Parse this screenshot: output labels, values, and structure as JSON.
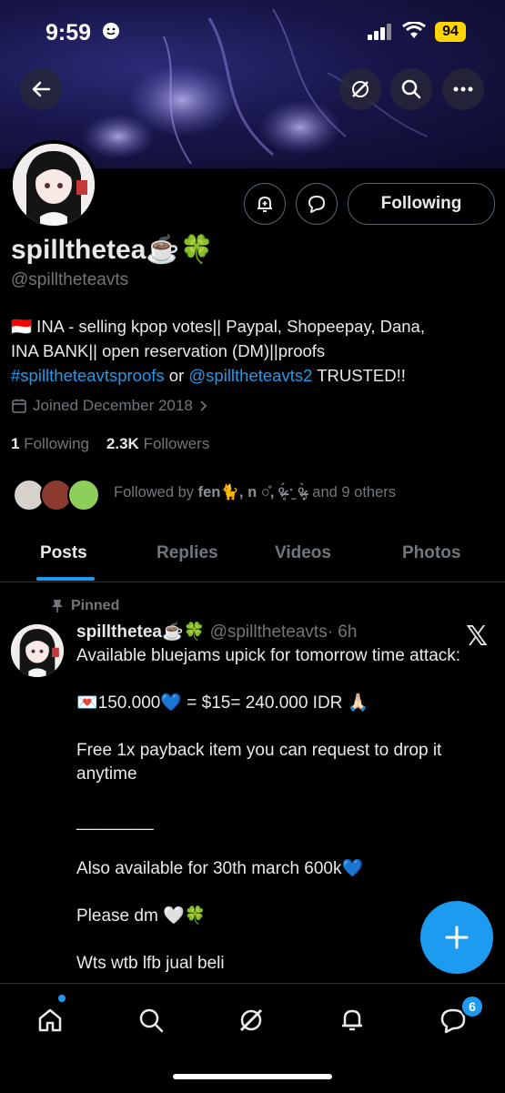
{
  "status_bar": {
    "time": "9:59",
    "battery": "94"
  },
  "profile": {
    "name": "spillthetea☕️🍀",
    "handle": "@spilltheteavts",
    "following_button": "Following",
    "bio": {
      "line1": "🇮🇩 INA - selling kpop votes|| Paypal, Shopeepay, Dana,",
      "line2": "INA BANK|| open reservation (DM)||proofs",
      "link1": "#spilltheteavtsproofs",
      "or": " or ",
      "link2": "@spilltheteavts2",
      "trusted": " TRUSTED!!"
    },
    "joined": "Joined December 2018",
    "following_count": "1",
    "following_label": "Following",
    "followers_count": "2.3K",
    "followers_label": "Followers",
    "followed_by_prefix": "Followed by ",
    "followed_by_names": "fen🐈, n ○̊, ᵒ̴̶̷̥́ ˑ̫ ᵒ̴̶̷̣̥̀",
    "followed_by_suffix": ", and 9 others"
  },
  "tabs": [
    "Posts",
    "Replies",
    "Videos",
    "Photos"
  ],
  "post": {
    "pinned_label": "Pinned",
    "name": "spillthetea☕️🍀",
    "handle": "@spilltheteavts",
    "time": "· 6h",
    "lines": [
      "Available bluejams upick for tomorrow time attack:",
      "💌150.000💙 = $15= 240.000 IDR 🙏🏻",
      "Free 1x payback item you can request to drop it anytime",
      "________",
      "Also available for 30th march 600k💙",
      "Please dm 🤍🍀",
      "Wts wtb lfb jual beli"
    ]
  },
  "nav": {
    "messages_badge": "6"
  },
  "colors": {
    "accent": "#1d9bf0",
    "background": "#000000",
    "text": "#e7e9ea",
    "muted": "#71767b"
  }
}
